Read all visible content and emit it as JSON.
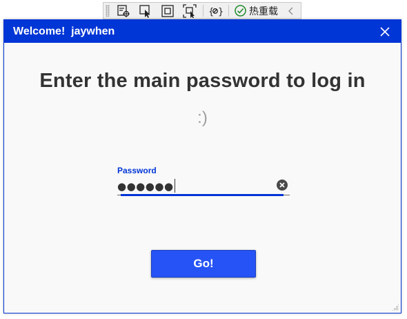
{
  "toolbar": {
    "hot_reload_label": "热重载",
    "icons": [
      "select-element-icon",
      "pointer-icon",
      "display-layout-icon",
      "track-focus-icon",
      "binding-failures-icon",
      "hot-reload-ok-icon",
      "collapse-icon"
    ]
  },
  "window": {
    "title": "Welcome!  jaywhen",
    "accent_color": "#0035d6"
  },
  "main": {
    "heading": "Enter the main password to log in",
    "smiley": ":)",
    "password_field": {
      "label": "Password",
      "value": "●●●●●●"
    },
    "go_button_label": "Go!"
  }
}
